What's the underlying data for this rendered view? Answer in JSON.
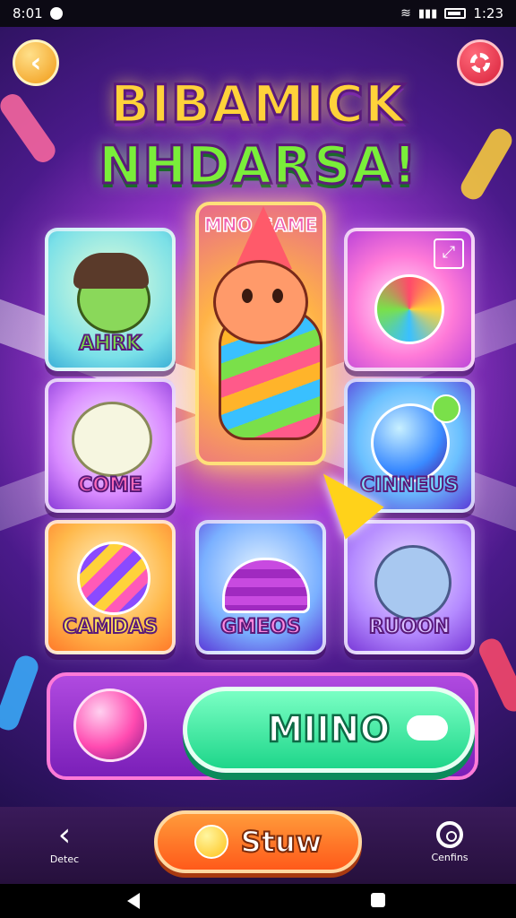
{
  "status_bar": {
    "time": "8:01",
    "right_time": "1:23"
  },
  "header": {
    "title_line1": "BIBAMICK",
    "title_line2": "NHDARSA!"
  },
  "cards": {
    "top_left": "AHRK",
    "featured": "MNO GAME",
    "middle_left": "COME",
    "middle_right": "CINNEUS",
    "bottom_left": "CAMDAS",
    "bottom_center": "GMEOS",
    "bottom_right": "RUOON"
  },
  "play_button": {
    "label": "MIINO"
  },
  "navbar": {
    "left_label": "Detec",
    "start_label": "Stuw",
    "right_label": "Cenfins"
  },
  "colors": {
    "accent_green": "#1ed68a",
    "accent_orange": "#ff5a1a",
    "background_purple": "#4a1a8a"
  }
}
